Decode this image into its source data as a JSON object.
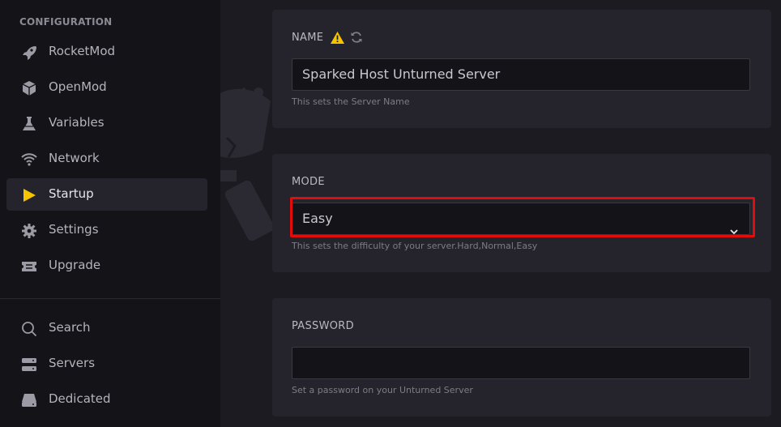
{
  "sidebar": {
    "section_heading": "CONFIGURATION",
    "items": [
      {
        "label": "RocketMod",
        "icon": "rocket-icon"
      },
      {
        "label": "OpenMod",
        "icon": "cube-icon"
      },
      {
        "label": "Variables",
        "icon": "flask-icon"
      },
      {
        "label": "Network",
        "icon": "wifi-icon"
      },
      {
        "label": "Startup",
        "icon": "play-icon",
        "active": true
      },
      {
        "label": "Settings",
        "icon": "gear-icon"
      },
      {
        "label": "Upgrade",
        "icon": "ticket-icon"
      }
    ],
    "bottom_items": [
      {
        "label": "Search",
        "icon": "search-icon"
      },
      {
        "label": "Servers",
        "icon": "server-icon"
      },
      {
        "label": "Dedicated",
        "icon": "hard-drive-icon"
      }
    ]
  },
  "main": {
    "name_card": {
      "title": "NAME",
      "value": "Sparked Host Unturned Server",
      "help": "This sets the Server Name",
      "icons": [
        "warning-icon",
        "refresh-icon"
      ]
    },
    "mode_card": {
      "title": "MODE",
      "selected": "Easy",
      "help": "This sets the difficulty of your server.Hard,Normal,Easy"
    },
    "password_card": {
      "title": "PASSWORD",
      "value": "",
      "help": "Set a password on your Unturned Server"
    }
  },
  "colors": {
    "accent_yellow": "#f7c500",
    "highlight_red": "#e10d0d",
    "sidebar_bg": "#141317",
    "card_bg": "#25242c"
  }
}
